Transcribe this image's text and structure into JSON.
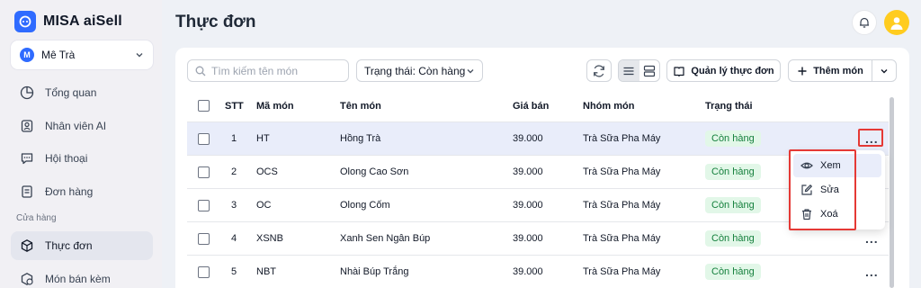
{
  "app": {
    "brand": "MISA aiSell"
  },
  "store": {
    "initial": "M",
    "name": "Mê Trà"
  },
  "sidebar": {
    "items": [
      {
        "label": "Tổng quan",
        "icon": "chart-pie-icon"
      },
      {
        "label": "Nhân viên AI",
        "icon": "ai-agent-icon"
      },
      {
        "label": "Hội thoại",
        "icon": "chat-icon"
      },
      {
        "label": "Đơn hàng",
        "icon": "order-icon"
      }
    ],
    "section": "Cửa hàng",
    "store_items": [
      {
        "label": "Thực đơn",
        "icon": "cube-icon",
        "active": true
      },
      {
        "label": "Món bán kèm",
        "icon": "addon-icon"
      }
    ]
  },
  "page": {
    "title": "Thực đơn"
  },
  "toolbar": {
    "search_placeholder": "Tìm kiếm tên món",
    "status_filter": "Trạng thái: Còn hàng",
    "manage_label": "Quản lý thực đơn",
    "add_label": "Thêm món"
  },
  "table": {
    "columns": [
      "STT",
      "Mã món",
      "Tên món",
      "Giá bán",
      "Nhóm món",
      "Trạng thái"
    ],
    "rows": [
      {
        "stt": "1",
        "code": "HT",
        "name": "Hồng Trà",
        "price": "39.000",
        "group": "Trà Sữa Pha Máy",
        "status": "Còn hàng"
      },
      {
        "stt": "2",
        "code": "OCS",
        "name": "Olong Cao Sơn",
        "price": "39.000",
        "group": "Trà Sữa Pha Máy",
        "status": "Còn hàng"
      },
      {
        "stt": "3",
        "code": "OC",
        "name": "Olong Cốm",
        "price": "39.000",
        "group": "Trà Sữa Pha Máy",
        "status": "Còn hàng"
      },
      {
        "stt": "4",
        "code": "XSNB",
        "name": "Xanh Sen Ngân Búp",
        "price": "39.000",
        "group": "Trà Sữa Pha Máy",
        "status": "Còn hàng"
      },
      {
        "stt": "5",
        "code": "NBT",
        "name": "Nhài Búp Trắng",
        "price": "39.000",
        "group": "Trà Sữa Pha Máy",
        "status": "Còn hàng"
      }
    ],
    "more_label": "..."
  },
  "context_menu": {
    "items": [
      {
        "label": "Xem",
        "icon": "eye-icon"
      },
      {
        "label": "Sửa",
        "icon": "edit-icon"
      },
      {
        "label": "Xoá",
        "icon": "trash-icon"
      }
    ]
  },
  "colors": {
    "accent": "#2f6bff",
    "status_bg": "#e2f7e8",
    "status_text": "#15803d",
    "highlight": "#e53935"
  }
}
